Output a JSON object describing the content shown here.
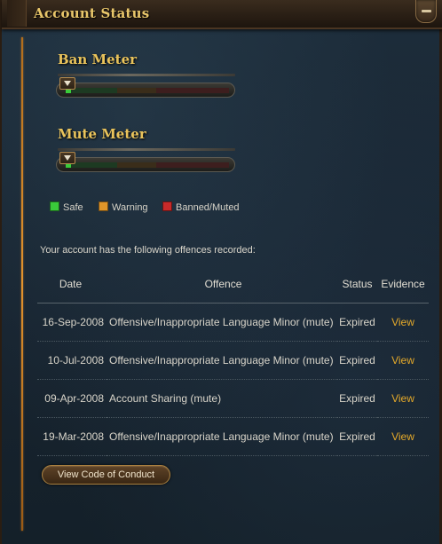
{
  "header": {
    "title": "Account Status",
    "collapse_icon": "minus-icon"
  },
  "colors": {
    "title_gold": "#e9c35b",
    "link_orange": "#e4a92a",
    "safe": "#3acb3a",
    "warning": "#e0962a",
    "banned_muted": "#c82a2a"
  },
  "meters": {
    "ban": {
      "label": "Ban Meter",
      "level_percent": 3
    },
    "mute": {
      "label": "Mute Meter",
      "level_percent": 3
    }
  },
  "legend": {
    "safe": "Safe",
    "warning": "Warning",
    "banned_muted": "Banned/Muted"
  },
  "intro_text": "Your account has the following offences recorded:",
  "table": {
    "headers": {
      "date": "Date",
      "offence": "Offence",
      "status": "Status",
      "evidence": "Evidence"
    },
    "rows": [
      {
        "date": "16-Sep-2008",
        "offence": "Offensive/Inappropriate Language Minor (mute)",
        "status": "Expired",
        "evidence": "View"
      },
      {
        "date": "10-Jul-2008",
        "offence": "Offensive/Inappropriate Language Minor (mute)",
        "status": "Expired",
        "evidence": "View"
      },
      {
        "date": "09-Apr-2008",
        "offence": "Account Sharing (mute)",
        "status": "Expired",
        "evidence": "View"
      },
      {
        "date": "19-Mar-2008",
        "offence": "Offensive/Inappropriate Language Minor (mute)",
        "status": "Expired",
        "evidence": "View"
      }
    ]
  },
  "code_of_conduct_button": "View Code of Conduct"
}
